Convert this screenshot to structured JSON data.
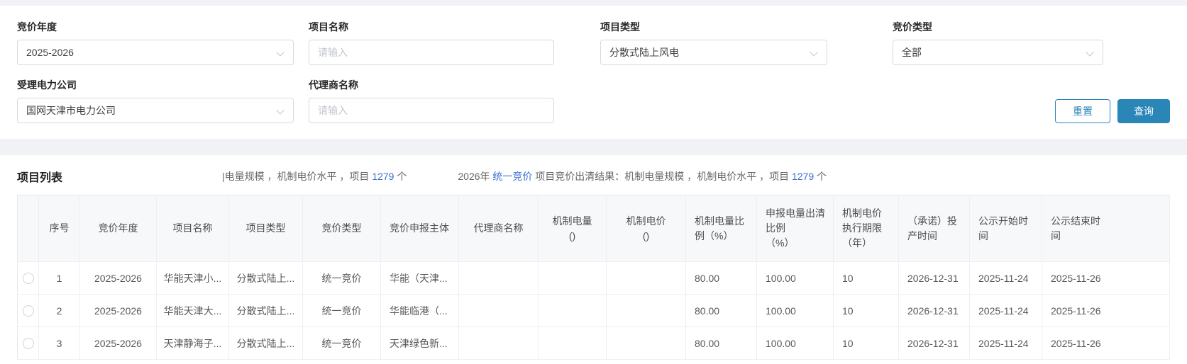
{
  "colors": {
    "primary": "#2b86b8",
    "link": "#3b6fd4"
  },
  "filters": {
    "fields": [
      {
        "label": "竞价年度",
        "type": "select",
        "value": "2025-2026"
      },
      {
        "label": "项目名称",
        "type": "input",
        "placeholder": "请输入"
      },
      {
        "label": "项目类型",
        "type": "select",
        "value": "分散式陆上风电"
      },
      {
        "label": "竞价类型",
        "type": "select",
        "value": "全部"
      },
      {
        "label": "受理电力公司",
        "type": "select",
        "value": "国网天津市电力公司"
      },
      {
        "label": "代理商名称",
        "type": "input",
        "placeholder": "请输入"
      }
    ],
    "reset_label": "重置",
    "search_label": "查询"
  },
  "list": {
    "title": "项目列表",
    "summary1": {
      "prefix": "|电量规模 ，机制电价水平 ，项目 ",
      "count": "1279",
      "suffix": " 个"
    },
    "summary2": {
      "prefix": "2026年 ",
      "link": "统一竞价",
      "middle": " 项目竞价出清结果：机制电量规模 ，机制电价水平 ，项目 ",
      "count": "1279",
      "suffix": " 个"
    }
  },
  "table": {
    "headers": [
      {
        "label": "序号",
        "sub": ""
      },
      {
        "label": "竞价年度",
        "sub": ""
      },
      {
        "label": "项目名称",
        "sub": ""
      },
      {
        "label": "项目类型",
        "sub": ""
      },
      {
        "label": "竞价类型",
        "sub": ""
      },
      {
        "label": "竞价申报主体",
        "sub": ""
      },
      {
        "label": "代理商名称",
        "sub": ""
      },
      {
        "label": "机制电量",
        "sub": "()"
      },
      {
        "label": "机制电价",
        "sub": "()"
      },
      {
        "label": "机制电量比例（%）",
        "sub": ""
      },
      {
        "label": "申报电量出清比例",
        "sub": "（%）"
      },
      {
        "label": "机制电价执行期限",
        "sub": "（年）"
      },
      {
        "label": "（承诺）投产时间",
        "sub": ""
      },
      {
        "label": "公示开始时间",
        "sub": ""
      },
      {
        "label": "公示结束时间",
        "sub": ""
      }
    ],
    "rows": [
      {
        "cells": [
          "1",
          "2025-2026",
          "华能天津小...",
          "分散式陆上...",
          "统一竞价",
          "华能（天津...",
          "",
          "",
          "",
          "80.00",
          "100.00",
          "10",
          "2026-12-31",
          "2025-11-24",
          "2025-11-26"
        ]
      },
      {
        "cells": [
          "2",
          "2025-2026",
          "华能天津大...",
          "分散式陆上...",
          "统一竞价",
          "华能临港（...",
          "",
          "",
          "",
          "80.00",
          "100.00",
          "10",
          "2026-12-31",
          "2025-11-24",
          "2025-11-26"
        ]
      },
      {
        "cells": [
          "3",
          "2025-2026",
          "天津静海子...",
          "分散式陆上...",
          "统一竞价",
          "天津绿色新...",
          "",
          "",
          "",
          "80.00",
          "100.00",
          "10",
          "2026-12-31",
          "2025-11-24",
          "2025-11-26"
        ]
      }
    ]
  }
}
